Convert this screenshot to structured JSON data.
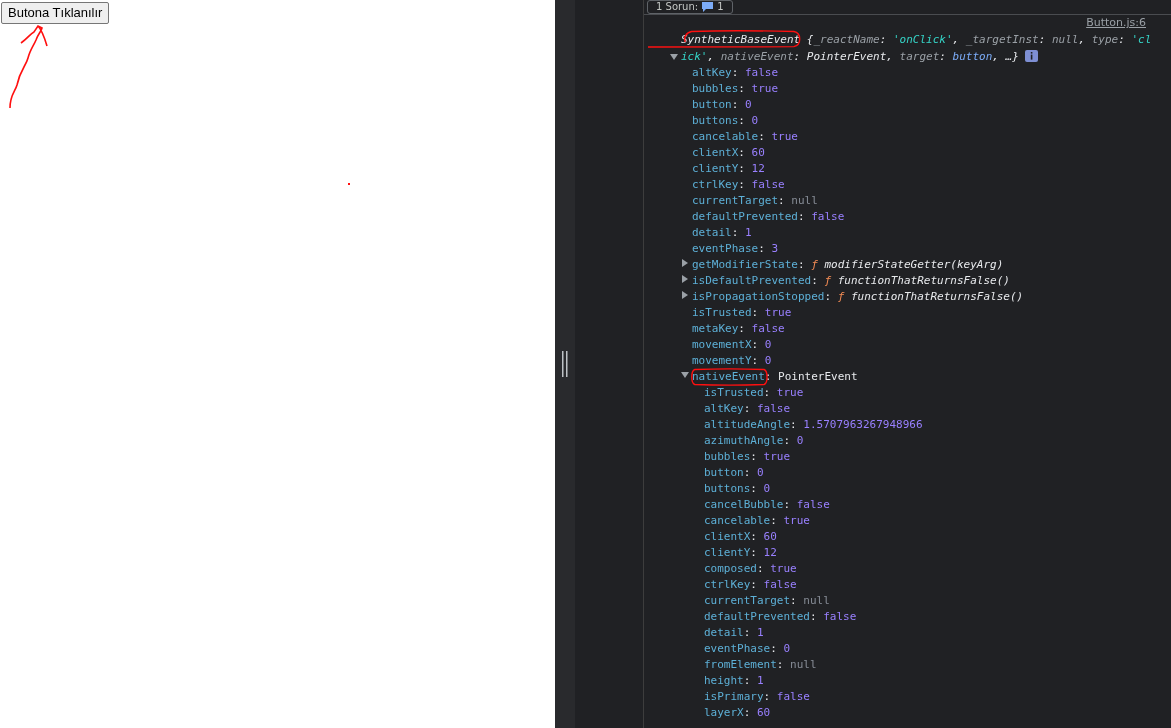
{
  "page": {
    "button": "Butona Tıklanılır"
  },
  "console": {
    "toolbar": {
      "issues_label": "1 Sorun:",
      "issues_count": "1"
    },
    "entry": {
      "source": "Button.js:6",
      "class_name": "SyntheticBaseEvent",
      "expanded": true,
      "separator": ":",
      "preview": [
        {
          "text": " {",
          "kind": "punct"
        },
        {
          "text": "_reactName",
          "kind": "key"
        },
        {
          "text": ": ",
          "kind": "punct"
        },
        {
          "text": "'onClick'",
          "kind": "string"
        },
        {
          "text": ", ",
          "kind": "punct"
        },
        {
          "text": "_targetInst",
          "kind": "key"
        },
        {
          "text": ": ",
          "kind": "punct"
        },
        {
          "text": "null",
          "kind": "null"
        },
        {
          "text": ", ",
          "kind": "punct"
        },
        {
          "text": "type",
          "kind": "key"
        },
        {
          "text": ": ",
          "kind": "punct"
        },
        {
          "text": "'click'",
          "kind": "string"
        },
        {
          "text": ", ",
          "kind": "punct"
        },
        {
          "text": "nativeEvent",
          "kind": "key"
        },
        {
          "text": ": ",
          "kind": "punct"
        },
        {
          "text": "PointerEvent",
          "kind": "object"
        },
        {
          "text": ", ",
          "kind": "punct"
        },
        {
          "text": "target",
          "kind": "key"
        },
        {
          "text": ": ",
          "kind": "punct"
        },
        {
          "text": "button",
          "kind": "node"
        },
        {
          "text": ", …}",
          "kind": "punct"
        }
      ],
      "properties": [
        {
          "name": "altKey",
          "kind": "primitive",
          "value": "false"
        },
        {
          "name": "bubbles",
          "kind": "primitive",
          "value": "true"
        },
        {
          "name": "button",
          "kind": "primitive",
          "value": "0"
        },
        {
          "name": "buttons",
          "kind": "primitive",
          "value": "0"
        },
        {
          "name": "cancelable",
          "kind": "primitive",
          "value": "true"
        },
        {
          "name": "clientX",
          "kind": "primitive",
          "value": "60"
        },
        {
          "name": "clientY",
          "kind": "primitive",
          "value": "12"
        },
        {
          "name": "ctrlKey",
          "kind": "primitive",
          "value": "false"
        },
        {
          "name": "currentTarget",
          "kind": "null",
          "value": "null"
        },
        {
          "name": "defaultPrevented",
          "kind": "primitive",
          "value": "false"
        },
        {
          "name": "detail",
          "kind": "primitive",
          "value": "1"
        },
        {
          "name": "eventPhase",
          "kind": "primitive",
          "value": "3"
        },
        {
          "name": "getModifierState",
          "kind": "function",
          "marker": "ƒ",
          "value": "modifierStateGetter(keyArg)",
          "expanded": false
        },
        {
          "name": "isDefaultPrevented",
          "kind": "function",
          "marker": "ƒ",
          "value": "functionThatReturnsFalse()",
          "expanded": false
        },
        {
          "name": "isPropagationStopped",
          "kind": "function",
          "marker": "ƒ",
          "value": "functionThatReturnsFalse()",
          "expanded": false
        },
        {
          "name": "isTrusted",
          "kind": "primitive",
          "value": "true"
        },
        {
          "name": "metaKey",
          "kind": "primitive",
          "value": "false"
        },
        {
          "name": "movementX",
          "kind": "primitive",
          "value": "0"
        },
        {
          "name": "movementY",
          "kind": "primitive",
          "value": "0"
        },
        {
          "name": "nativeEvent",
          "kind": "object",
          "value": "PointerEvent",
          "expanded": true,
          "children": [
            {
              "name": "isTrusted",
              "kind": "primitive",
              "value": "true"
            },
            {
              "name": "altKey",
              "kind": "primitive",
              "value": "false"
            },
            {
              "name": "altitudeAngle",
              "kind": "primitive",
              "value": "1.5707963267948966"
            },
            {
              "name": "azimuthAngle",
              "kind": "primitive",
              "value": "0"
            },
            {
              "name": "bubbles",
              "kind": "primitive",
              "value": "true"
            },
            {
              "name": "button",
              "kind": "primitive",
              "value": "0"
            },
            {
              "name": "buttons",
              "kind": "primitive",
              "value": "0"
            },
            {
              "name": "cancelBubble",
              "kind": "primitive",
              "value": "false"
            },
            {
              "name": "cancelable",
              "kind": "primitive",
              "value": "true"
            },
            {
              "name": "clientX",
              "kind": "primitive",
              "value": "60"
            },
            {
              "name": "clientY",
              "kind": "primitive",
              "value": "12"
            },
            {
              "name": "composed",
              "kind": "primitive",
              "value": "true"
            },
            {
              "name": "ctrlKey",
              "kind": "primitive",
              "value": "false"
            },
            {
              "name": "currentTarget",
              "kind": "null",
              "value": "null"
            },
            {
              "name": "defaultPrevented",
              "kind": "primitive",
              "value": "false"
            },
            {
              "name": "detail",
              "kind": "primitive",
              "value": "1"
            },
            {
              "name": "eventPhase",
              "kind": "primitive",
              "value": "0"
            },
            {
              "name": "fromElement",
              "kind": "null",
              "value": "null"
            },
            {
              "name": "height",
              "kind": "primitive",
              "value": "1"
            },
            {
              "name": "isPrimary",
              "kind": "primitive",
              "value": "false"
            },
            {
              "name": "layerX",
              "kind": "primitive",
              "value": "60"
            }
          ]
        }
      ]
    }
  }
}
